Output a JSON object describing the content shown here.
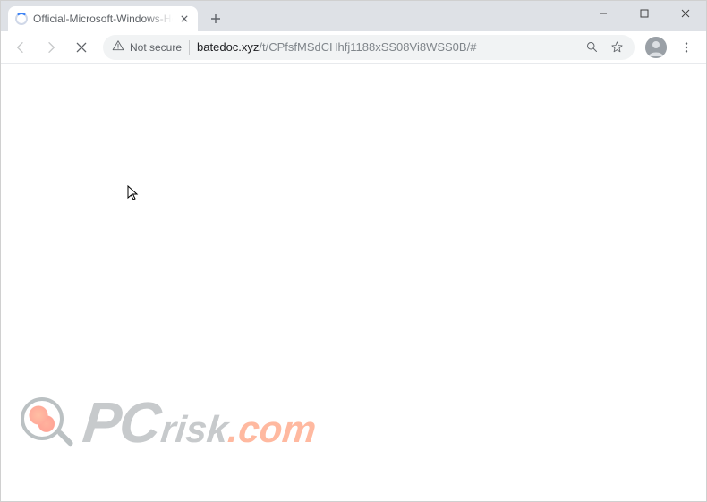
{
  "tab": {
    "title": "Official-Microsoft-Windows-Help"
  },
  "addressbar": {
    "security_label": "Not secure",
    "url_host": "batedoc.xyz",
    "url_path": "/t/CPfsfMSdCHhfj1188xSS08Vi8WSS0B/#"
  },
  "watermark": {
    "pc": "PC",
    "risk": "risk",
    "com": ".com"
  }
}
